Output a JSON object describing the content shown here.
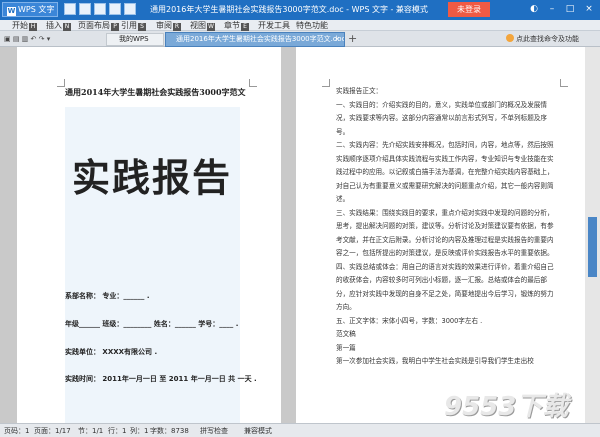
{
  "app": {
    "name": "WPS 文字",
    "window_title": "通用2016年大学生暑期社会实践报告3000字范文.doc - WPS 文字 - 兼容模式",
    "login_label": "未登录"
  },
  "ribbon": {
    "tabs": [
      {
        "label": "开始",
        "key": "H"
      },
      {
        "label": "插入",
        "key": "N"
      },
      {
        "label": "页面布局",
        "key": "P"
      },
      {
        "label": "引用",
        "key": "S"
      },
      {
        "label": "审阅",
        "key": "R"
      },
      {
        "label": "视图",
        "key": "W"
      },
      {
        "label": "章节",
        "key": "E"
      },
      {
        "label": "开发工具",
        "key": ""
      },
      {
        "label": "特色功能",
        "key": ""
      }
    ]
  },
  "tabs": {
    "home": "我的WPS",
    "doc": "通用2016年大学生暑期社会实践报告3000字范文.doc",
    "help": "点此查找命令及功能"
  },
  "page1": {
    "header": "通用2014年大学生暑期社会实践报告3000字范文",
    "big_title": "实践报告",
    "fields": [
      "系部名称：  专业：______ .",
      "年级______ 班级：________ 姓名：______ 学号：____ .",
      "实践单位：  XXXX有限公司 .",
      "实践时间：  2011年一月一日  至  2011 年一月一日  共 一天 ."
    ]
  },
  "page2": {
    "lines": [
      "实践报告正文：",
      "一、实践目的：介绍实践的目的，意义，实践单位或部门的概况及发展情况，实践要求等内容。这部分内容通常以前言形式列写，不单列标题及序号。",
      "二、实践内容：先介绍实践安排概况，包括时间，内容，地点等，然后按照实践顺序逐项介绍具体实践流程与实践工作内容，专业知识与专业技能在实践过程中的应用。以记叙或白描手法为基调，在完整介绍实践内容基础上，对自己认为有重要意义或需要研究解决的问题重点介绍，其它一般内容则简述。",
      "三、实践结果：围绕实践目的要求，重点介绍对实践中发现的问题的分析，思考，提出解决问题的对策，建议等。分析讨论及对策建议要有依据，有参考文献，并在正文后附录。分析讨论的内容及推理过程是实践报告的重要内容之一，包括所提出的对策建议，是反映或评价实践报告水平的重要依据。",
      "四、实践总结或体会：用自己的语言对实践的效果进行评价，着重介绍自己的收获体会，内容较多时可列出小标题，逐一汇报。总结或体会的最后部分，应针对实践中发现的自身不足之处，简要地提出今后学习，锻炼的努力方向。",
      "五、正文字体：宋体小四号，字数：3000字左右 .",
      "范文稿",
      "第一篇",
      "第一次参加社会实践，我明白中学生社会实践是引导我们学生走出校"
    ]
  },
  "status": {
    "items": [
      "页码：1",
      "页面：1/17",
      "节：1/1",
      "行：1",
      "列：1",
      "字数：8738",
      "拼写检查",
      "兼容模式"
    ]
  },
  "watermark": "9553下载"
}
